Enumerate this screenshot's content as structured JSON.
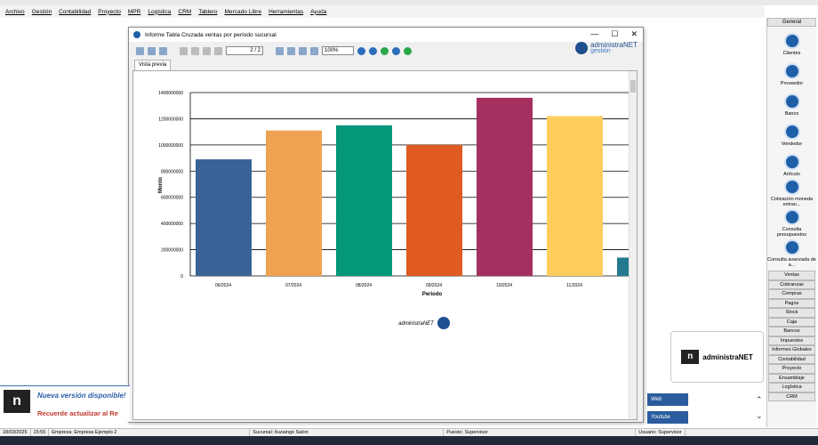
{
  "menu": [
    "Archivo",
    "Gestión",
    "Contabilidad",
    "Proyecto",
    "MPR",
    "Logística",
    "CRM",
    "Tablero",
    "Mercado Libre",
    "Herramientas",
    "Ayuda"
  ],
  "window": {
    "title": "Informe Tabla Cruzada ventas por período sucursal",
    "page": "2 / 2",
    "zoom": "100%",
    "tab": "Vista previa",
    "brand_main": "administraNET",
    "brand_sub": "gestión",
    "footer_brand": "administraNET"
  },
  "chart_data": {
    "type": "bar",
    "categories": [
      "06/2024",
      "07/2024",
      "08/2024",
      "09/2024",
      "10/2024",
      "11/2024",
      ""
    ],
    "values": [
      890000000,
      1110000000,
      1150000000,
      1000000000,
      1360000000,
      1220000000,
      140000000
    ],
    "colors": [
      "#3a6296",
      "#efa352",
      "#04977a",
      "#df5b21",
      "#a3305f",
      "#fdce5d",
      "#237a8e"
    ],
    "yticks": [
      "0",
      "200000000",
      "400000000",
      "600000000",
      "800000000",
      "1000000000",
      "1200000000",
      "1400000000"
    ],
    "xlabel": "Periodo",
    "ylabel": "Monto",
    "ylim": [
      0,
      1400000000
    ],
    "grid": true
  },
  "right_panel": {
    "header": "General",
    "items": [
      "Clientes",
      "Proveedor",
      "Banco",
      "Vendedor",
      "Artículo",
      "Cotización moneda extran...",
      "Consulta presupuestos",
      "Consulta avanzada de a..."
    ],
    "sections": [
      "Ventas",
      "Cobranzas",
      "Compras",
      "Pagos",
      "Stock",
      "Caja",
      "Bancos",
      "Impuestos",
      "Informes Globales",
      "Contabilidad",
      "Proyecto",
      "Ensamblaje",
      "Logística",
      "CRM"
    ]
  },
  "promo": {
    "title": "Nueva versión disponible!",
    "subtitle": "Recuerde actualizar al Re"
  },
  "card_brand": "administraNET",
  "social": {
    "web": "Web",
    "youtube": "Youtube"
  },
  "status": {
    "date": "18/03/2025",
    "time": "15:55",
    "empresa": "Empresa: Empresa Ejemplo 2",
    "sucursal": "Sucursal: Ituzaingo Salon",
    "puesto": "Puesto: Supervisor",
    "usuario": "Usuario: Supervisor"
  }
}
